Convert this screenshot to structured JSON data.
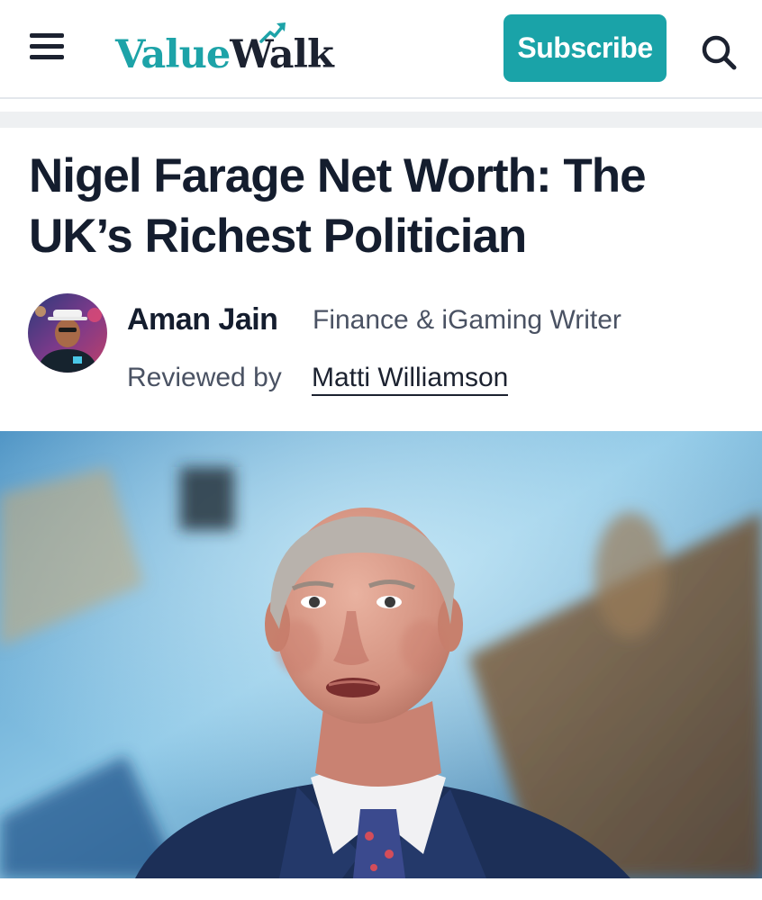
{
  "header": {
    "menu_icon": "hamburger-menu-icon",
    "logo": {
      "part1": "Value",
      "part2": "Walk",
      "accent_color": "#1da3a8",
      "dark_color": "#1c2230"
    },
    "subscribe_label": "Subscribe",
    "subscribe_color": "#1aa3a8",
    "search_icon": "search-icon"
  },
  "article": {
    "title": "Nigel Farage Net Worth: The UK’s Richest Politician",
    "author": {
      "name": "Aman Jain",
      "role": "Finance & iGaming Writer"
    },
    "reviewed_label": "Reviewed by",
    "reviewer": "Matti Williamson"
  }
}
